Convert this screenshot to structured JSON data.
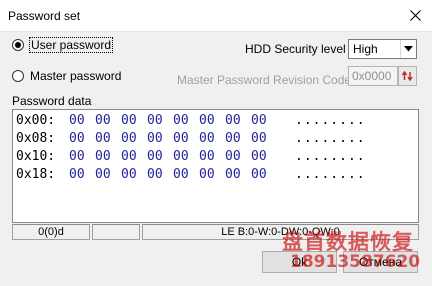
{
  "window": {
    "title": "Password set"
  },
  "options": {
    "user_password": "User password",
    "master_password": "Master password",
    "selected": "user_password"
  },
  "hdd_security": {
    "label": "HDD Security level",
    "value": "High"
  },
  "master_revision": {
    "label": "Master Password Revision Code",
    "value": "0x0000"
  },
  "password_data": {
    "label": "Password data",
    "rows": [
      {
        "offset": "0x00:",
        "bytes": [
          "00",
          "00",
          "00",
          "00",
          "00",
          "00",
          "00",
          "00"
        ],
        "ascii": "........"
      },
      {
        "offset": "0x08:",
        "bytes": [
          "00",
          "00",
          "00",
          "00",
          "00",
          "00",
          "00",
          "00"
        ],
        "ascii": "........"
      },
      {
        "offset": "0x10:",
        "bytes": [
          "00",
          "00",
          "00",
          "00",
          "00",
          "00",
          "00",
          "00"
        ],
        "ascii": "........"
      },
      {
        "offset": "0x18:",
        "bytes": [
          "00",
          "00",
          "00",
          "00",
          "00",
          "00",
          "00",
          "00"
        ],
        "ascii": "........"
      }
    ]
  },
  "status": {
    "position": "0(0)d",
    "middle": "",
    "info": "LE B:0-W:0-DW:0-QW:0"
  },
  "buttons": {
    "ok": "Ok",
    "cancel": "Отмена"
  },
  "watermark": {
    "line1": "盘首数据恢复",
    "line2": "18913587620"
  },
  "colors": {
    "hex_bytes": "#1f1f9f",
    "watermark": "#c80000",
    "window_bg": "#f0f0f0"
  }
}
